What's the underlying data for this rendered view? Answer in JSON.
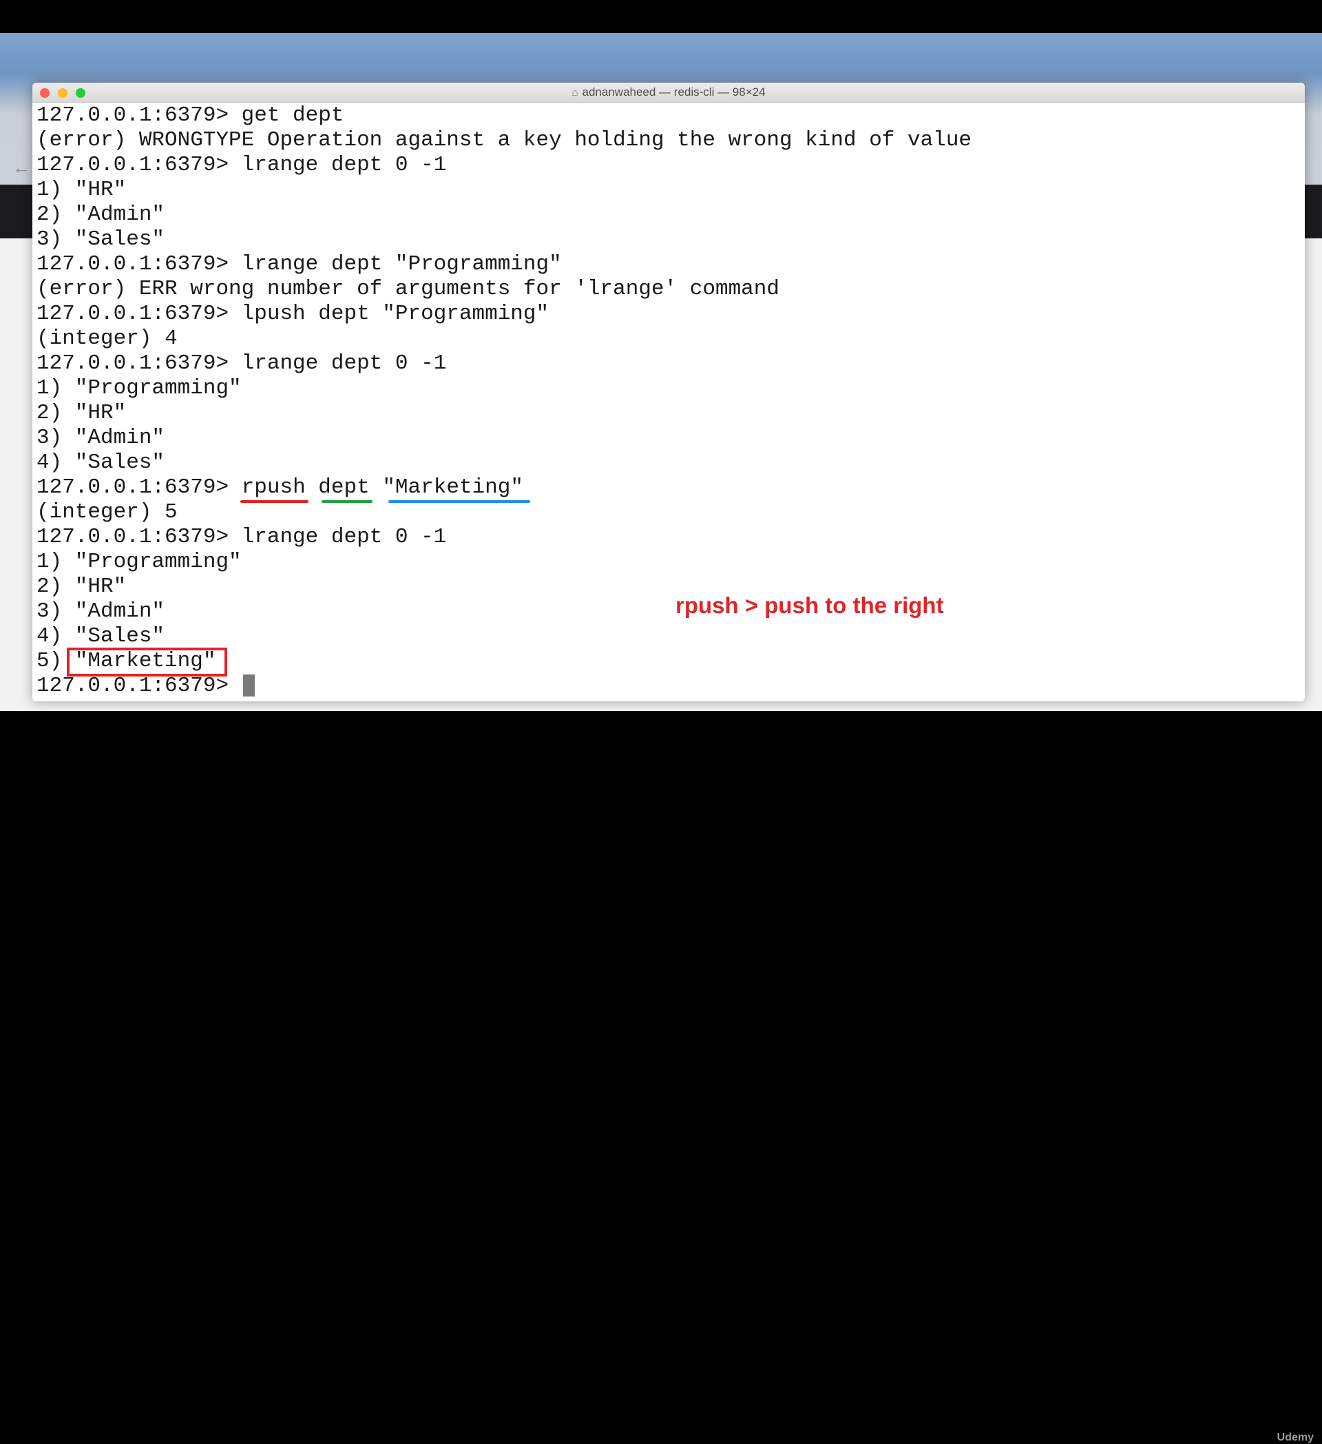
{
  "window": {
    "title": "adnanwaheed — redis-cli — 98×24",
    "home_icon": "home-icon"
  },
  "terminal": {
    "lines": [
      "127.0.0.1:6379> get dept",
      "(error) WRONGTYPE Operation against a key holding the wrong kind of value",
      "127.0.0.1:6379> lrange dept 0 -1",
      "1) \"HR\"",
      "2) \"Admin\"",
      "3) \"Sales\"",
      "127.0.0.1:6379> lrange dept \"Programming\"",
      "(error) ERR wrong number of arguments for 'lrange' command",
      "127.0.0.1:6379> lpush dept \"Programming\"",
      "(integer) 4",
      "127.0.0.1:6379> lrange dept 0 -1",
      "1) \"Programming\"",
      "2) \"HR\"",
      "3) \"Admin\"",
      "4) \"Sales\"",
      "",
      "(integer) 5",
      "127.0.0.1:6379> lrange dept 0 -1",
      "1) \"Programming\"",
      "2) \"HR\"",
      "3) \"Admin\"",
      "4) \"Sales\"",
      "",
      "127.0.0.1:6379> "
    ],
    "rpush_line": {
      "prompt": "127.0.0.1:6379> ",
      "command": "rpush",
      "key": "dept",
      "value": "\"Marketing\""
    },
    "marketing_line": {
      "index": "5) ",
      "value": "\"Marketing\""
    }
  },
  "annotation": {
    "text": "rpush > push to the right",
    "color": "#e0242a"
  },
  "underline_colors": {
    "command": "#e02424",
    "key": "#23a047",
    "value": "#1e90e8"
  },
  "watermark": "Udemy"
}
